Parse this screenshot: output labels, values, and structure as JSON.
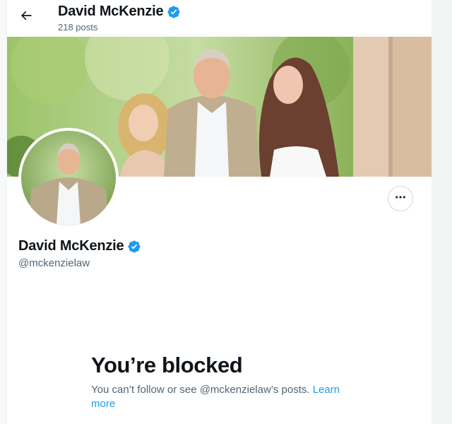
{
  "header": {
    "back_icon": "arrow-left-icon",
    "name": "David McKenzie",
    "posts_count": "218 posts",
    "verified_icon": "verified-badge-icon"
  },
  "profile": {
    "name": "David McKenzie",
    "handle": "@mckenzielaw",
    "more_icon": "more-horizontal-icon"
  },
  "blocked": {
    "title": "You’re blocked",
    "message": "You can’t follow or see @mckenzielaw’s posts.",
    "learn_more": "Learn more"
  },
  "colors": {
    "accent": "#1d9bf0",
    "text_primary": "#0f1419",
    "text_secondary": "#536471"
  }
}
